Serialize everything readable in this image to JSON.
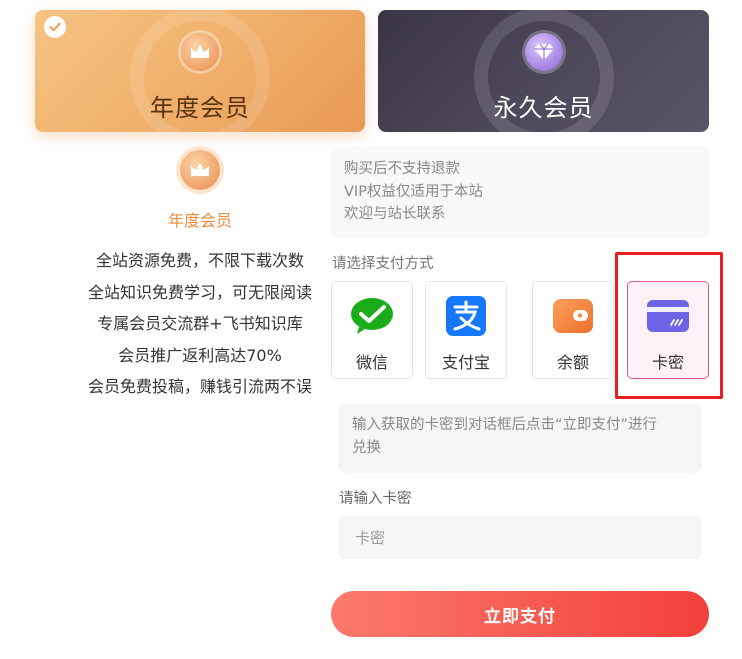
{
  "plans": [
    {
      "title": "年度会员",
      "icon": "crown-icon",
      "selected": true
    },
    {
      "title": "永久会员",
      "icon": "diamond-icon",
      "selected": false
    }
  ],
  "selected_plan": {
    "icon": "crown-icon",
    "name": "年度会员",
    "benefits": [
      "全站资源免费，不限下载次数",
      "全站知识免费学习，可无限阅读",
      "专属会员交流群+飞书知识库",
      "会员推广返利高达70%",
      "会员免费投稿，赚钱引流两不误"
    ]
  },
  "notice": {
    "lines": [
      "购买后不支持退款",
      "VIP权益仅适用于本站",
      "欢迎与站长联系"
    ]
  },
  "payment": {
    "label": "请选择支付方式",
    "methods": [
      {
        "name": "微信",
        "icon": "wechat-icon",
        "color": "#1aad19"
      },
      {
        "name": "支付宝",
        "icon": "alipay-icon",
        "color": "#1677ff"
      },
      {
        "name": "余额",
        "icon": "wallet-icon",
        "color": "#f5863c"
      },
      {
        "name": "卡密",
        "icon": "card-icon",
        "color": "#6c63e6",
        "selected": true
      }
    ]
  },
  "card": {
    "hint_lines": [
      "输入获取的卡密到对话框后点击“立即支付”进行",
      "兑换"
    ],
    "label": "请输入卡密",
    "placeholder": "卡密",
    "value": ""
  },
  "submit_label": "立即支付",
  "colors": {
    "accent_orange": "#ef8a3c",
    "pay_button_start": "#fb7a6b",
    "pay_button_end": "#f2403c",
    "highlight_red": "#ee1d1d"
  }
}
